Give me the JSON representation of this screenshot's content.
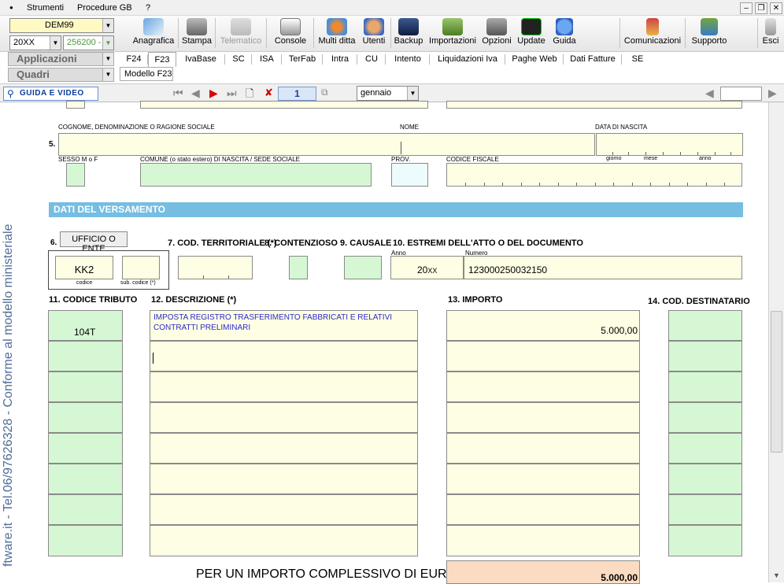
{
  "menu": {
    "items": [
      "Strumenti",
      "Procedure GB",
      "?"
    ]
  },
  "selectors": {
    "ditta": "DEM99",
    "anno": "20XX",
    "codice": "256200 -"
  },
  "toolbar": {
    "buttons": [
      "Anagrafica",
      "Stampa",
      "Telematico",
      "Console",
      "Multi ditta",
      "Utenti",
      "Backup",
      "Importazioni",
      "Opzioni",
      "Update",
      "Guida"
    ],
    "right_buttons": [
      "Comunicazioni",
      "Supporto",
      "Esci"
    ]
  },
  "sidebar": {
    "applicazioni": "Applicazioni",
    "quadri": "Quadri"
  },
  "tabs": [
    "F24",
    "F23",
    "IvaBase",
    "SC",
    "ISA",
    "TerFab",
    "Intra",
    "CU",
    "Intento",
    "Liquidazioni Iva",
    "Paghe Web",
    "Dati Fatture",
    "SE"
  ],
  "subtab": "Modello F23",
  "navbar": {
    "guida": "GUIDA E VIDEO",
    "page": "1",
    "month": "gennaio"
  },
  "form": {
    "vertical_text": "ftware.it - Tel.06/97626328 - Conforme al modello ministeriale",
    "section5": {
      "number": "5.",
      "labels": {
        "cognome": "COGNOME, DENOMINAZIONE O RAGIONE SOCIALE",
        "nome": "NOME",
        "data_nascita": "DATA DI NASCITA",
        "giorno": "giorno",
        "mese": "mese",
        "anno": "anno",
        "sesso": "SESSO M o F",
        "comune": "COMUNE (o stato estero) DI NASCITA / SEDE SOCIALE",
        "prov": "PROV.",
        "codice_fiscale": "CODICE FISCALE"
      }
    },
    "section_title": "DATI DEL VERSAMENTO",
    "headers": {
      "ufficio_num": "6.",
      "ufficio_btn": "UFFICIO O ENTE",
      "cod_territoriale": "7. COD. TERRITORIALE (*)",
      "contenzioso": "8. CONTENZIOSO",
      "causale": "9. CAUSALE",
      "estremi": "10. ESTREMI DELL'ATTO O DEL DOCUMENTO",
      "anno": "Anno",
      "numero": "Numero",
      "codice": "codice",
      "sub_codice": "sub. codice (*)",
      "codice_tributo": "11. CODICE TRIBUTO",
      "descrizione": "12. DESCRIZIONE (*)",
      "importo": "13. IMPORTO",
      "cod_destinatario": "14. COD. DESTINATARIO"
    },
    "values": {
      "ufficio_codice": "KK2",
      "anno": "20",
      "anno_suffix": "XX",
      "numero": "123000250032150",
      "codice_tributo": "104T",
      "descrizione": "IMPOSTA REGISTRO TRASFERIMENTO FABBRICATI E RELATIVI CONTRATTI PRELIMINARI",
      "importo": "5.000,00",
      "totale": "5.000,00"
    },
    "total_label": "PER UN IMPORTO COMPLESSIVO DI EURO"
  },
  "colors": {
    "section": "#76bde2",
    "field": "#fefee4",
    "field_green": "#d6f7d3",
    "vertical_text": "#4f6c97",
    "description_text": "#2a2ad0"
  }
}
